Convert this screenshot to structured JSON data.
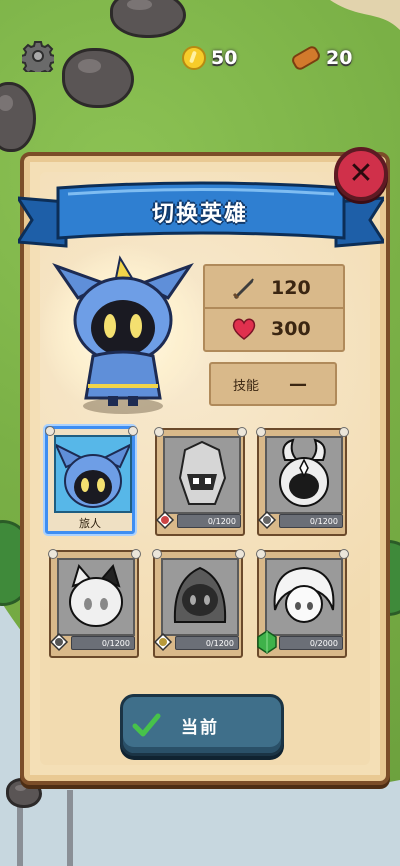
{
  "hud": {
    "coins": "50",
    "wood": "20"
  },
  "panel": {
    "title": "切换英雄",
    "stats": {
      "attack": "120",
      "health": "300"
    },
    "skill": {
      "label": "技能",
      "value": "—"
    }
  },
  "heroes": [
    {
      "name": "旅人",
      "selected": true
    },
    {
      "progress": "0/1200"
    },
    {
      "progress": "0/1200"
    },
    {
      "progress": "0/1200"
    },
    {
      "progress": "0/1200"
    },
    {
      "progress": "0/2000"
    }
  ],
  "button": {
    "label": "当前"
  },
  "colors": {
    "panel": "#f4dfb6",
    "ribbon": "#2f7fd1",
    "selected_border": "#3f8ef1",
    "close": "#d0304a",
    "button": "#3f6f8a"
  }
}
